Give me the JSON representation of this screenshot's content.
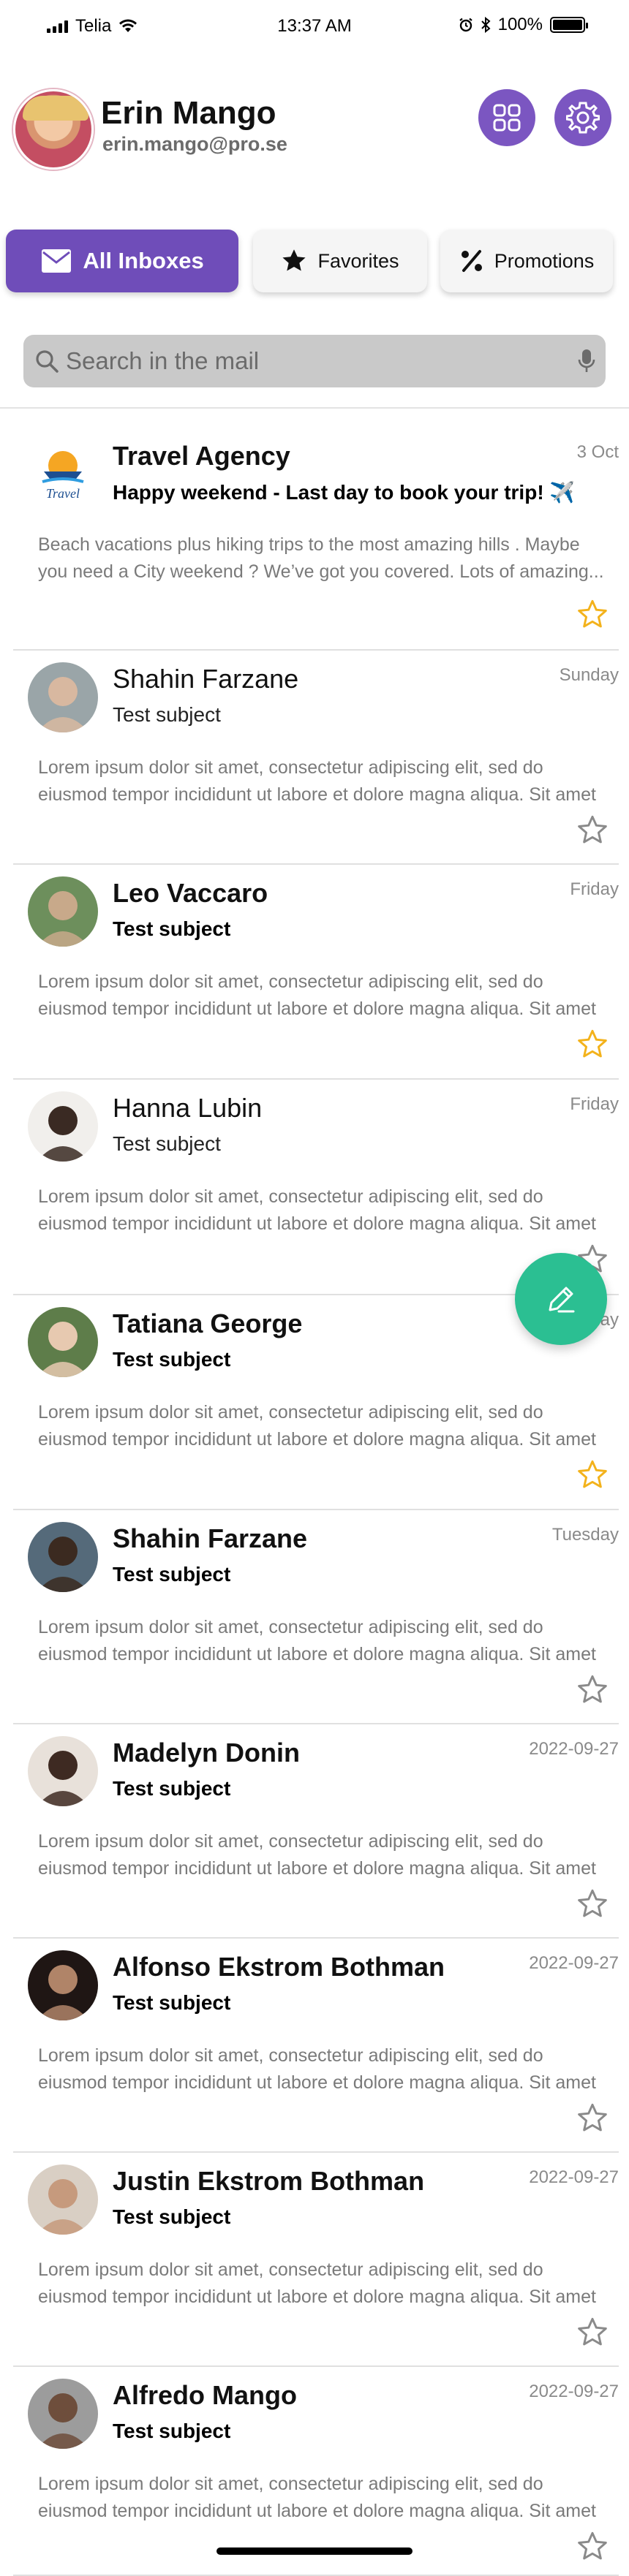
{
  "status_bar": {
    "carrier": "Telia",
    "time": "13:37 AM",
    "battery": "100%"
  },
  "profile": {
    "name": "Erin Mango",
    "email": "erin.mango@pro.se"
  },
  "tabs": [
    {
      "label": "All Inboxes",
      "icon": "mail-icon",
      "active": true
    },
    {
      "label": "Favorites",
      "icon": "star-icon",
      "active": false
    },
    {
      "label": "Promotions",
      "icon": "percent-icon",
      "active": false
    }
  ],
  "search": {
    "placeholder": "Search in the mail",
    "value": ""
  },
  "emails": [
    {
      "sender": "Travel Agency",
      "subject": "Happy weekend - Last day to book your trip! ✈️",
      "date": "3 Oct",
      "preview1": "Beach vacations plus hiking trips to the most amazing hills . Maybe",
      "preview2": "you need a City weekend ? We’ve got you covered. Lots of amazing...",
      "starred": true,
      "unread": true,
      "avatar_text": "Travel"
    },
    {
      "sender": "Shahin Farzane",
      "subject": "Test subject",
      "date": "Sunday",
      "preview1": "Lorem ipsum dolor sit amet, consectetur adipiscing elit, sed do",
      "preview2": "eiusmod tempor incididunt ut labore et dolore magna aliqua. Sit amet",
      "starred": false,
      "unread": false
    },
    {
      "sender": "Leo Vaccaro",
      "subject": "Test subject",
      "date": "Friday",
      "preview1": "Lorem ipsum dolor sit amet, consectetur adipiscing elit, sed do",
      "preview2": "eiusmod tempor incididunt ut labore et dolore magna aliqua. Sit amet",
      "starred": true,
      "unread": true
    },
    {
      "sender": "Hanna Lubin",
      "subject": "Test subject",
      "date": "Friday",
      "preview1": "Lorem ipsum dolor sit amet, consectetur adipiscing elit, sed do",
      "preview2": "eiusmod tempor incididunt ut labore et dolore magna aliqua. Sit amet",
      "starred": false,
      "unread": false
    },
    {
      "sender": "Tatiana George",
      "subject": "Test subject",
      "date": "Friday",
      "preview1": "Lorem ipsum dolor sit amet, consectetur adipiscing elit, sed do",
      "preview2": "eiusmod tempor incididunt ut labore et dolore magna aliqua. Sit amet",
      "starred": true,
      "unread": true
    },
    {
      "sender": "Shahin Farzane",
      "subject": "Test subject",
      "date": "Tuesday",
      "preview1": "Lorem ipsum dolor sit amet, consectetur adipiscing elit, sed do",
      "preview2": "eiusmod tempor incididunt ut labore et dolore magna aliqua. Sit amet",
      "starred": false,
      "unread": true
    },
    {
      "sender": "Madelyn Donin",
      "subject": "Test subject",
      "date": "2022-09-27",
      "preview1": "Lorem ipsum dolor sit amet, consectetur adipiscing elit, sed do",
      "preview2": "eiusmod tempor incididunt ut labore et dolore magna aliqua. Sit amet",
      "starred": false,
      "unread": true
    },
    {
      "sender": "Alfonso Ekstrom Bothman",
      "subject": "Test subject",
      "date": "2022-09-27",
      "preview1": "Lorem ipsum dolor sit amet, consectetur adipiscing elit, sed do",
      "preview2": "eiusmod tempor incididunt ut labore et dolore magna aliqua. Sit amet",
      "starred": false,
      "unread": true
    },
    {
      "sender": "Justin Ekstrom Bothman",
      "subject": "Test subject",
      "date": "2022-09-27",
      "preview1": "Lorem ipsum dolor sit amet, consectetur adipiscing elit, sed do",
      "preview2": "eiusmod tempor incididunt ut labore et dolore magna aliqua. Sit amet",
      "starred": false,
      "unread": true
    },
    {
      "sender": "Alfredo Mango",
      "subject": "Test subject",
      "date": "2022-09-27",
      "preview1": "Lorem ipsum dolor sit amet, consectetur adipiscing elit, sed do",
      "preview2": "eiusmod tempor incididunt ut labore et dolore magna aliqua. Sit amet",
      "starred": false,
      "unread": true
    }
  ],
  "colors": {
    "accent_purple": "#6f4db9",
    "fab_green": "#2bbf92",
    "star_gold": "#f3b21b",
    "star_outline": "#8a8a8a"
  },
  "icons": {
    "grid_button": "grid-icon",
    "settings_button": "gear-icon",
    "fab": "compose-pencil-icon",
    "search": "search-icon",
    "mic": "microphone-icon"
  }
}
